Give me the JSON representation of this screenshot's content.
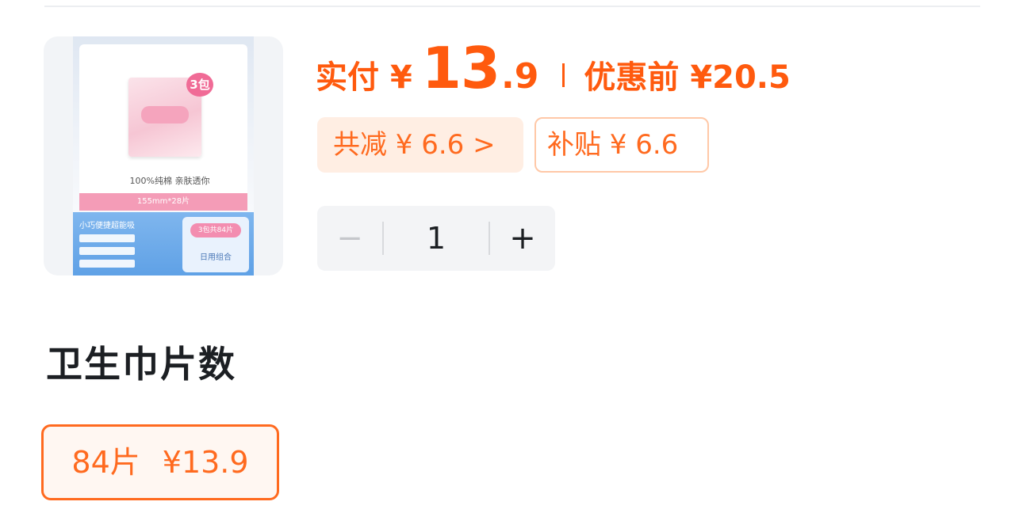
{
  "product": {
    "image": {
      "badge": "3包",
      "tagline": "100%纯棉 亲肤透你",
      "size_label": "155mm*28片",
      "blue_title": "小巧便捷超能吸",
      "pack_pill": "3包共84片",
      "combo_label": "日用组合"
    }
  },
  "price": {
    "pay_label": "实付",
    "currency": "¥",
    "pay_integer": "13",
    "pay_decimal": ".9",
    "original_text": "优惠前 ¥20.5",
    "accent_color": "#ff5a0e"
  },
  "tags": {
    "discount": "共减 ¥ 6.6 >",
    "subsidy": "补贴 ¥ 6.6"
  },
  "stepper": {
    "minus": "−",
    "value": "1",
    "plus": "+"
  },
  "spec": {
    "title": "卫生巾片数",
    "options": [
      {
        "label": "84片",
        "price": "¥13.9",
        "selected": true
      }
    ]
  }
}
